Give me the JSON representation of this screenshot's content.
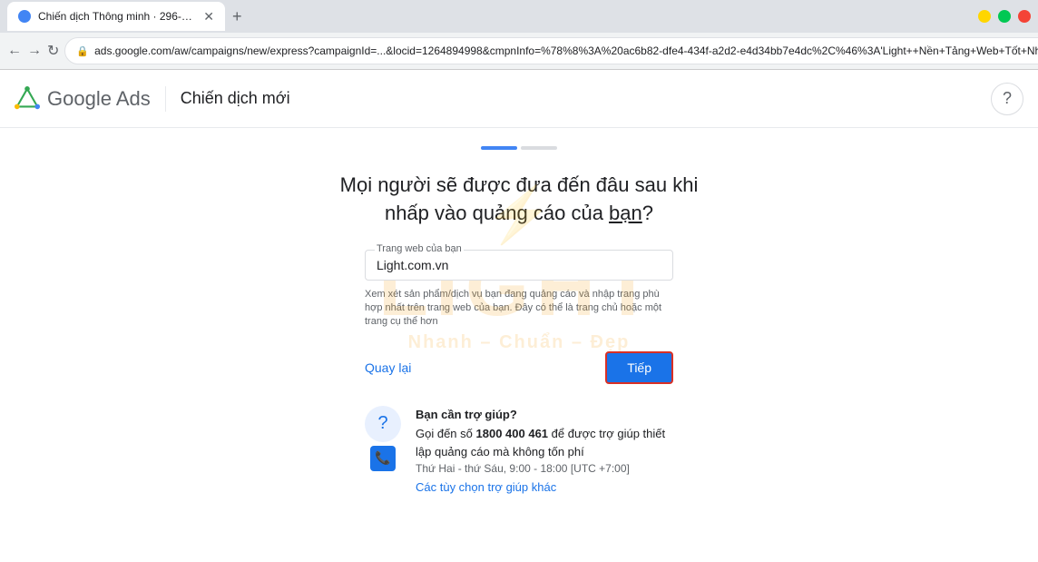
{
  "browser": {
    "tab_title": "Chiến dịch Thông minh · 296-0...",
    "url": "ads.google.com/aw/campaigns/new/express?campaignId=...",
    "url_full": "ads.google.com/aw/campaigns/new/express?campaignId=...&locid=1264894998&cmpnInfo=%78%8%3A%20ac6b82-dfe4-434f-a2d2-e4d34bb7e4dc%2C%46%3A'Light++Nền+Tảng+Web+Tốt+Nhất+Cho+Chạy+Quảng+Cáo+Bán+Hàng+...",
    "new_tab_label": "+"
  },
  "header": {
    "app_name": "Google Ads",
    "campaign_title": "Chiến dịch mới",
    "help_icon": "?"
  },
  "progress": {
    "segments": [
      {
        "active": true
      },
      {
        "active": false
      }
    ]
  },
  "page": {
    "question_line1": "Mọi người sẽ được đưa đến đâu sau khi",
    "question_line2": "nhấp vào quảng cáo của bạn?",
    "underline_word": "bạn",
    "field_label": "Trang web của bạn",
    "field_value": "Light.com.vn",
    "field_hint": "Xem xét sản phẩm/dịch vụ bạn đang quảng cáo và nhập trang phù hợp nhất trên trang web của bạn. Đây có thể là trang chủ hoặc một trang cụ thể hơn",
    "back_label": "Quay lại",
    "next_label": "Tiếp"
  },
  "help": {
    "title": "Bạn cần trợ giúp?",
    "call_text": "Gọi đến số ",
    "phone": "1800 400 461",
    "call_suffix": " để được trợ giúp thiết lập quảng cáo mà không tốn phí",
    "hours": "Thứ Hai - thứ Sáu, 9:00 - 18:00 [UTC +7:00]",
    "link_label": "Các tùy chọn trợ giúp khác"
  },
  "watermark": {
    "logo": "LIGHT",
    "tagline": "Nhanh – Chuẩn – Đẹp"
  }
}
